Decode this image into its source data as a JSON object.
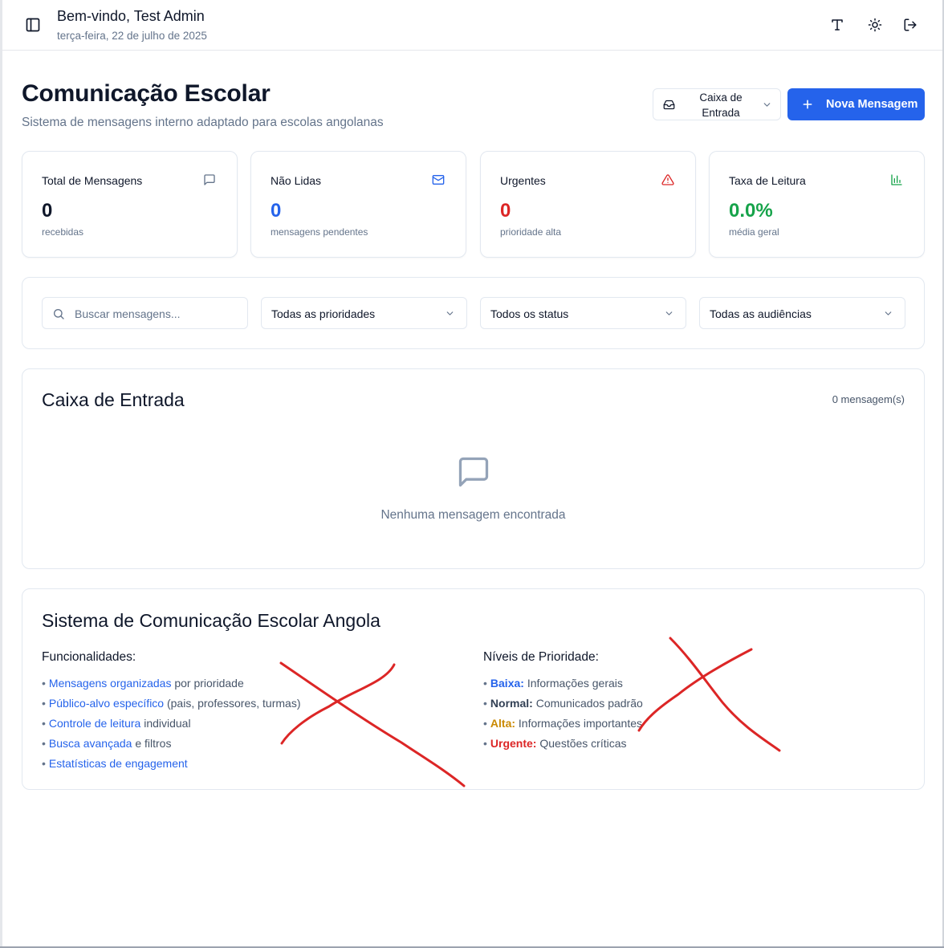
{
  "header": {
    "welcome": "Bem-vindo, Test Admin",
    "date": "terça-feira, 22 de julho de 2025"
  },
  "page": {
    "title": "Comunicação Escolar",
    "subtitle": "Sistema de mensagens interno adaptado para escolas angolanas",
    "folder_select": "Caixa de Entrada",
    "new_message_label": "Nova Mensagem"
  },
  "stats": [
    {
      "title": "Total de Mensagens",
      "value": "0",
      "sub": "recebidas",
      "color": "#0f172a",
      "icon": "message-square-icon"
    },
    {
      "title": "Não Lidas",
      "value": "0",
      "sub": "mensagens pendentes",
      "color": "#2563eb",
      "icon": "mail-icon"
    },
    {
      "title": "Urgentes",
      "value": "0",
      "sub": "prioridade alta",
      "color": "#dc2626",
      "icon": "alert-triangle-icon"
    },
    {
      "title": "Taxa de Leitura",
      "value": "0.0%",
      "sub": "média geral",
      "color": "#16a34a",
      "icon": "bar-chart-icon"
    }
  ],
  "filters": {
    "search_placeholder": "Buscar mensagens...",
    "priority": "Todas as prioridades",
    "status": "Todos os status",
    "audience": "Todas as audiências"
  },
  "inbox": {
    "title": "Caixa de Entrada",
    "count": "0 mensagem(s)",
    "empty": "Nenhuma mensagem encontrada"
  },
  "info": {
    "title": "Sistema de Comunicação Escolar Angola",
    "features_title": "Funcionalidades:",
    "features": [
      {
        "link": "Mensagens organizadas",
        "rest": " por prioridade"
      },
      {
        "link": "Público-alvo específico",
        "rest": " (pais, professores, turmas)"
      },
      {
        "link": "Controle de leitura",
        "rest": " individual"
      },
      {
        "link": "Busca avançada",
        "rest": " e filtros"
      },
      {
        "link": "Estatísticas de engagement",
        "rest": ""
      }
    ],
    "priorities_title": "Níveis de Prioridade:",
    "priorities": [
      {
        "label": "Baixa:",
        "desc": " Informações gerais",
        "color": "#2563eb"
      },
      {
        "label": "Normal:",
        "desc": " Comunicados padrão",
        "color": "#334155"
      },
      {
        "label": "Alta:",
        "desc": " Informações importantes",
        "color": "#ca8a04"
      },
      {
        "label": "Urgente:",
        "desc": " Questões críticas",
        "color": "#dc2626"
      }
    ]
  },
  "colors": {
    "accent": "#2563eb",
    "annotation_red": "#dc2626"
  }
}
